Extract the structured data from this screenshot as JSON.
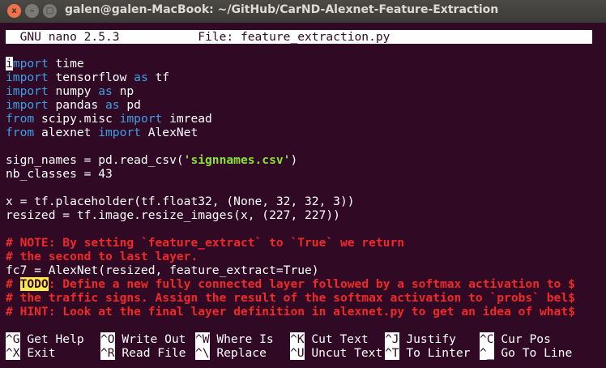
{
  "window": {
    "title": "galen@galen-MacBook: ~/GitHub/CarND-Alexnet-Feature-Extraction",
    "buttons": {
      "close": "x",
      "minimize": "–",
      "maximize": "□"
    }
  },
  "nano": {
    "header": "  GNU nano 2.5.3           File: feature_extraction.py",
    "lines": [
      [
        {
          "t": "i",
          "c": "cursor"
        },
        {
          "t": "mport",
          "c": "kw"
        },
        {
          "t": " time"
        }
      ],
      [
        {
          "t": "import",
          "c": "kw"
        },
        {
          "t": " tensorflow "
        },
        {
          "t": "as",
          "c": "kw"
        },
        {
          "t": " tf"
        }
      ],
      [
        {
          "t": "import",
          "c": "kw"
        },
        {
          "t": " numpy "
        },
        {
          "t": "as",
          "c": "kw"
        },
        {
          "t": " np"
        }
      ],
      [
        {
          "t": "import",
          "c": "kw"
        },
        {
          "t": " pandas "
        },
        {
          "t": "as",
          "c": "kw"
        },
        {
          "t": " pd"
        }
      ],
      [
        {
          "t": "from",
          "c": "kw"
        },
        {
          "t": " scipy.misc "
        },
        {
          "t": "import",
          "c": "kw"
        },
        {
          "t": " imread"
        }
      ],
      [
        {
          "t": "from",
          "c": "kw"
        },
        {
          "t": " alexnet "
        },
        {
          "t": "import",
          "c": "kw"
        },
        {
          "t": " AlexNet"
        }
      ],
      [],
      [
        {
          "t": "sign_names = pd.read_csv("
        },
        {
          "t": "'signnames.csv'",
          "c": "str"
        },
        {
          "t": ")"
        }
      ],
      [
        {
          "t": "nb_classes = 43"
        }
      ],
      [],
      [
        {
          "t": "x = tf.placeholder(tf.float32, (None, 32, 32, 3))"
        }
      ],
      [
        {
          "t": "resized = tf.image.resize_images(x, (227, 227))"
        }
      ],
      [],
      [
        {
          "t": "# NOTE: By setting `feature_extract` to `True` we return",
          "c": "cmt"
        }
      ],
      [
        {
          "t": "# the second to last layer.",
          "c": "cmt"
        }
      ],
      [
        {
          "t": "fc7 = AlexNet(resized, feature_extract=True)"
        }
      ],
      [
        {
          "t": "# ",
          "c": "cmt"
        },
        {
          "t": "TODO",
          "c": "todo"
        },
        {
          "t": ": Define a new fully connected layer followed by a softmax activation to $",
          "c": "cmt"
        }
      ],
      [
        {
          "t": "# the traffic signs. Assign the result of the softmax activation to `probs` bel$",
          "c": "cmt"
        }
      ],
      [
        {
          "t": "# HINT: Look at the final layer definition in alexnet.py to get an idea of what$",
          "c": "cmt"
        }
      ]
    ],
    "shortcuts_row1": [
      {
        "key": "^G",
        "label": " Get Help"
      },
      {
        "key": "^O",
        "label": " Write Out"
      },
      {
        "key": "^W",
        "label": " Where Is"
      },
      {
        "key": "^K",
        "label": " Cut Text"
      },
      {
        "key": "^J",
        "label": " Justify"
      },
      {
        "key": "^C",
        "label": " Cur Pos"
      }
    ],
    "shortcuts_row2": [
      {
        "key": "^X",
        "label": " Exit"
      },
      {
        "key": "^R",
        "label": " Read File"
      },
      {
        "key": "^\\",
        "label": " Replace"
      },
      {
        "key": "^U",
        "label": " Uncut Text"
      },
      {
        "key": "^T",
        "label": " To Linter"
      },
      {
        "key": "^_",
        "label": " Go To Line"
      }
    ]
  }
}
